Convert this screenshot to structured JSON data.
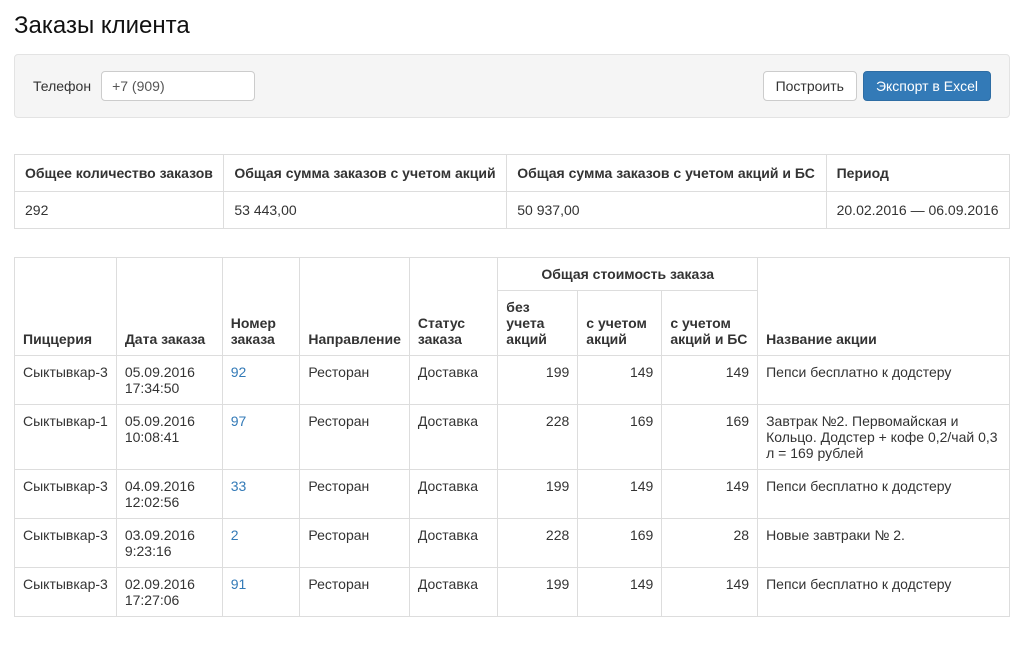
{
  "page": {
    "title": "Заказы клиента"
  },
  "toolbar": {
    "phone_label": "Телефон",
    "phone_value": "+7 (909)",
    "build_label": "Построить",
    "export_label": "Экспорт в Excel"
  },
  "summary": {
    "headers": {
      "total_count": "Общее количество заказов",
      "sum_with_promo": "Общая сумма заказов с учетом акций",
      "sum_with_promo_bs": "Общая сумма заказов с учетом акций и БС",
      "period": "Период"
    },
    "values": {
      "total_count": "292",
      "sum_with_promo": "53 443,00",
      "sum_with_promo_bs": "50 937,00",
      "period": "20.02.2016 — 06.09.2016"
    }
  },
  "orders": {
    "headers": {
      "pizzeria": "Пиццерия",
      "date": "Дата заказа",
      "order_no": "Номер заказа",
      "direction": "Направление",
      "status": "Статус заказа",
      "total_group": "Общая стоимость заказа",
      "no_promo": "без учета акций",
      "with_promo": "с учетом акций",
      "with_promo_bs": "с учетом акций и БС",
      "promo_name": "Название акции"
    },
    "rows": [
      {
        "pizzeria": "Сыктывкар-3",
        "date": "05.09.2016 17:34:50",
        "order_no": "92",
        "direction": "Ресторан",
        "status": "Доставка",
        "no_promo": "199",
        "with_promo": "149",
        "with_promo_bs": "149",
        "promo_name": "Пепси бесплатно к додстеру"
      },
      {
        "pizzeria": "Сыктывкар-1",
        "date": "05.09.2016 10:08:41",
        "order_no": "97",
        "direction": "Ресторан",
        "status": "Доставка",
        "no_promo": "228",
        "with_promo": "169",
        "with_promo_bs": "169",
        "promo_name": "Завтрак №2. Первомайская и Кольцо. Додстер + кофе 0,2/чай 0,3 л = 169 рублей"
      },
      {
        "pizzeria": "Сыктывкар-3",
        "date": "04.09.2016 12:02:56",
        "order_no": "33",
        "direction": "Ресторан",
        "status": "Доставка",
        "no_promo": "199",
        "with_promo": "149",
        "with_promo_bs": "149",
        "promo_name": "Пепси бесплатно к додстеру"
      },
      {
        "pizzeria": "Сыктывкар-3",
        "date": "03.09.2016 9:23:16",
        "order_no": "2",
        "direction": "Ресторан",
        "status": "Доставка",
        "no_promo": "228",
        "with_promo": "169",
        "with_promo_bs": "28",
        "promo_name": "Новые завтраки № 2."
      },
      {
        "pizzeria": "Сыктывкар-3",
        "date": "02.09.2016 17:27:06",
        "order_no": "91",
        "direction": "Ресторан",
        "status": "Доставка",
        "no_promo": "199",
        "with_promo": "149",
        "with_promo_bs": "149",
        "promo_name": "Пепси бесплатно к додстеру"
      }
    ]
  }
}
